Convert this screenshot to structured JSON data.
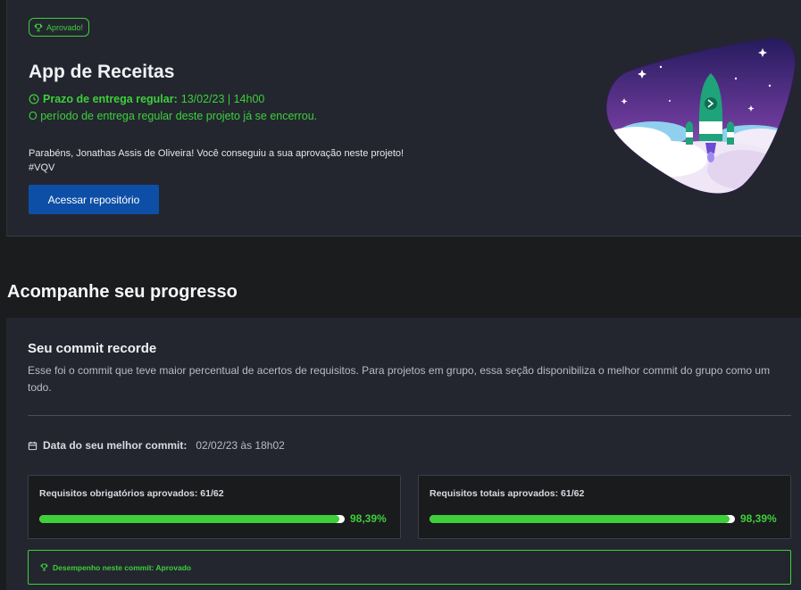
{
  "project": {
    "badge": "Aprovado!",
    "title": "App de Receitas",
    "deadline_label": "Prazo de entrega regular:",
    "deadline_value": "13/02/23 | 14h00",
    "deadline_note": "O período de entrega regular deste projeto já se encerrou.",
    "congrats_line1": "Parabéns, Jonathas Assis de Oliveira! Você conseguiu a sua aprovação neste projeto!",
    "congrats_line2": "#VQV",
    "repo_button": "Acessar repositório"
  },
  "progress": {
    "section_title": "Acompanhe seu progresso",
    "record_title": "Seu commit recorde",
    "record_desc": "Esse foi o commit que teve maior percentual de acertos de requisitos. Para projetos em grupo, essa seção disponibiliza o melhor commit do grupo como um todo.",
    "best_commit_label": "Data do seu melhor commit:",
    "best_commit_value": "02/02/23 às 18h02",
    "mandatory": {
      "label": "Requisitos obrigatórios aprovados: 61/62",
      "percent_text": "98,39%",
      "percent": 98.39
    },
    "total": {
      "label": "Requisitos totais aprovados: 61/62",
      "percent_text": "98,39%",
      "percent": 98.39
    },
    "performance": "Desempenho neste commit: Aprovado"
  },
  "colors": {
    "accent_green": "#3ecf3a",
    "button_blue": "#0d4fa6",
    "card_bg": "#23262f",
    "page_bg": "#1b1c1e"
  },
  "icons": [
    "trophy-icon",
    "clock-icon",
    "calendar-icon",
    "rocket-illustration"
  ]
}
